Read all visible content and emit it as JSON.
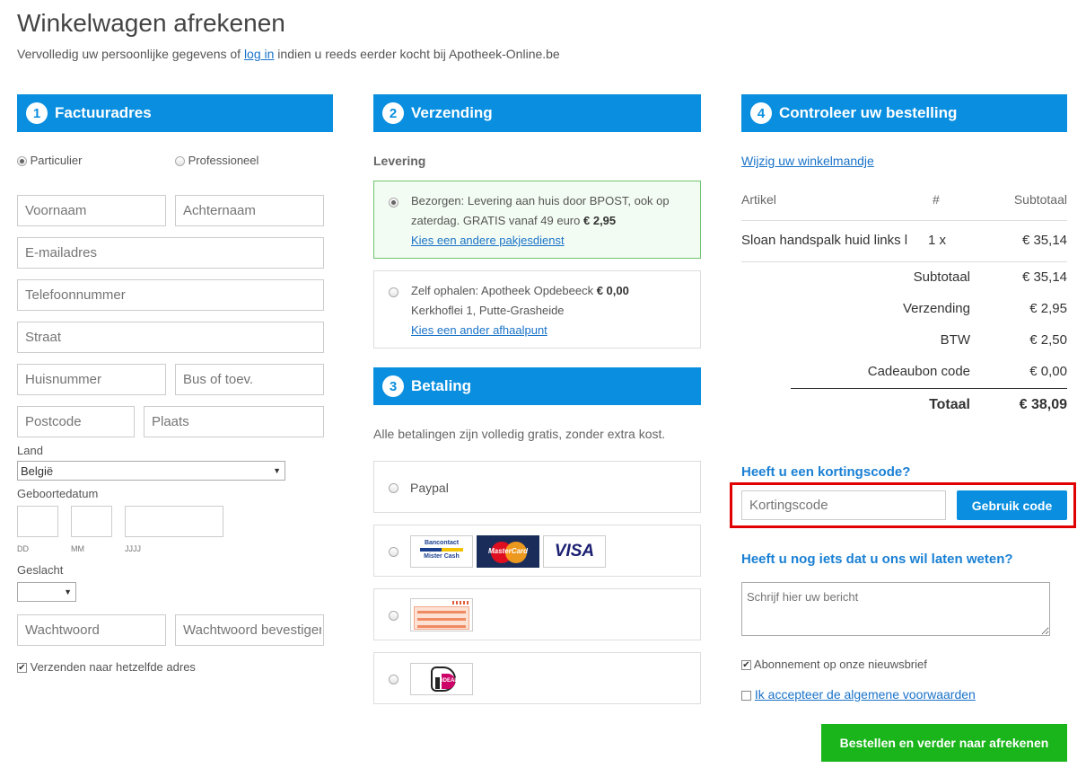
{
  "page": {
    "title": "Winkelwagen afrekenen",
    "subtitle_before": "Vervolledig uw persoonlijke gegevens of ",
    "subtitle_link": "log in",
    "subtitle_after": " indien u reeds eerder kocht bij Apotheek-Online.be"
  },
  "billing": {
    "number": "1",
    "header": "Factuuradres",
    "type_private": "Particulier",
    "type_business": "Professioneel",
    "placeholders": {
      "first_name": "Voornaam",
      "last_name": "Achternaam",
      "email": "E-mailadres",
      "phone": "Telefoonnummer",
      "street": "Straat",
      "house_number": "Huisnummer",
      "box": "Bus of toev.",
      "postcode": "Postcode",
      "city": "Plaats",
      "password": "Wachtwoord",
      "password_confirm": "Wachtwoord bevestigen"
    },
    "country_label": "Land",
    "country_value": "België",
    "birthdate_label": "Geboortedatum",
    "birth_dd": "DD",
    "birth_mm": "MM",
    "birth_yyyy": "JJJJ",
    "gender_label": "Geslacht",
    "ship_same": "Verzenden naar hetzelfde adres"
  },
  "shipping": {
    "number": "2",
    "header": "Verzending",
    "levering_label": "Levering",
    "option1_text": "Bezorgen: Levering aan huis door BPOST, ook op zaterdag. GRATIS vanaf 49 euro",
    "option1_price": "€ 2,95",
    "option1_link": "Kies een andere pakjesdienst",
    "option2_text": "Zelf ophalen: Apotheek Opdebeeck",
    "option2_price": "€ 0,00",
    "option2_address": "Kerkhoflei 1, Putte-Grasheide",
    "option2_link": "Kies een ander afhaalpunt"
  },
  "payment": {
    "number": "3",
    "header": "Betaling",
    "note": "Alle betalingen zijn volledig gratis, zonder extra kost.",
    "paypal": "Paypal",
    "bancontact_line1": "Bancontact",
    "bancontact_line2": "Mister Cash",
    "mastercard": "MasterCard",
    "visa": "VISA",
    "ideal": "iDEAL"
  },
  "review": {
    "number": "4",
    "header": "Controleer uw bestelling",
    "edit_cart_link": "Wijzig uw winkelmandje",
    "col_article": "Artikel",
    "col_qty": "#",
    "col_subtotal": "Subtotaal",
    "item_name": "Sloan handspalk huid links l",
    "item_qty": "1 x",
    "item_price": "€ 35,14",
    "subtotal_label": "Subtotaal",
    "subtotal_value": "€ 35,14",
    "shipping_label": "Verzending",
    "shipping_value": "€ 2,95",
    "vat_label": "BTW",
    "vat_value": "€ 2,50",
    "gift_label": "Cadeaubon code",
    "gift_value": "€ 0,00",
    "total_label": "Totaal",
    "total_value": "€ 38,09"
  },
  "discount": {
    "heading": "Heeft u een kortingscode?",
    "placeholder": "Kortingscode",
    "button": "Gebruik code"
  },
  "message": {
    "heading": "Heeft u nog iets dat u ons wil laten weten?",
    "placeholder": "Schrijf hier uw bericht"
  },
  "consents": {
    "newsletter": "Abonnement op onze nieuwsbrief",
    "terms_link": "Ik accepteer de algemene voorwaarden"
  },
  "submit": {
    "label": "Bestellen en verder naar afrekenen"
  },
  "colors": {
    "primary": "#0a8fe0",
    "success": "#1ab51a",
    "highlight": "#e00000"
  }
}
